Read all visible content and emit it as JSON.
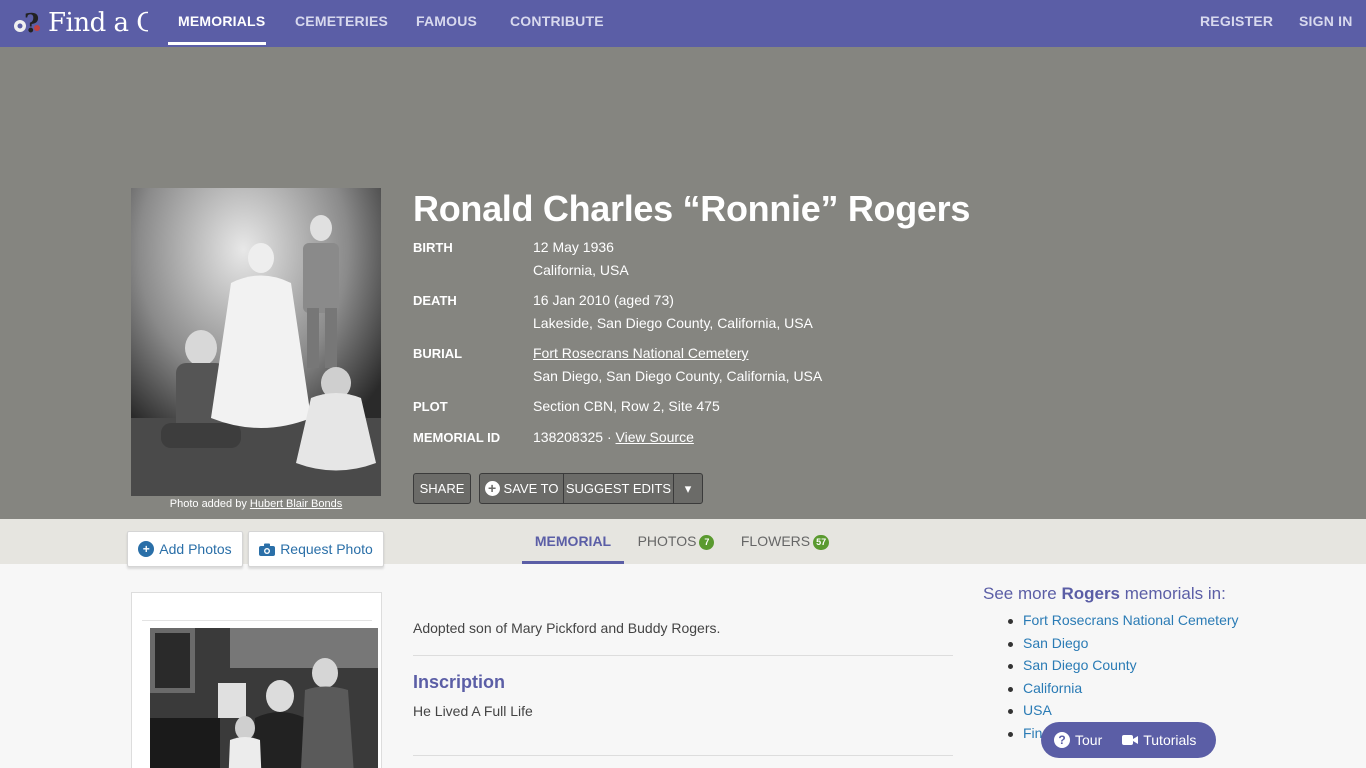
{
  "nav": {
    "logo_text": "Find a Gra",
    "items": [
      "MEMORIALS",
      "CEMETERIES",
      "FAMOUS",
      "CONTRIBUTE"
    ],
    "register": "REGISTER",
    "signin": "SIGN IN"
  },
  "memorial": {
    "name": "Ronald Charles “Ronnie” Rogers",
    "photo_credit_prefix": "Photo added by",
    "photo_credit_name": "Hubert Blair Bonds",
    "facts": {
      "birth_label": "BIRTH",
      "birth_date": "12 May 1936",
      "birth_place": "California, USA",
      "death_label": "DEATH",
      "death_date": "16 Jan 2010 (aged 73)",
      "death_place": "Lakeside, San Diego County, California, USA",
      "burial_label": "BURIAL",
      "burial_cemetery": "Fort Rosecrans National Cemetery",
      "burial_place": "San Diego, San Diego County, California, USA",
      "plot_label": "PLOT",
      "plot_value": "Section CBN, Row 2, Site 475",
      "id_label": "MEMORIAL ID",
      "id_value": "138208325 ·",
      "view_source": "View Source"
    },
    "buttons": {
      "share": "SHARE",
      "save_to": "SAVE TO",
      "suggest_edits": "SUGGEST EDITS",
      "caret": "▾"
    }
  },
  "side_buttons": {
    "add_photos": "Add Photos",
    "request_photo": "Request Photo"
  },
  "tabs": [
    {
      "label": "MEMORIAL"
    },
    {
      "label": "PHOTOS",
      "count": "7"
    },
    {
      "label": "FLOWERS",
      "count": "57"
    }
  ],
  "content": {
    "bio": "Adopted son of Mary Pickford and Buddy Rogers.",
    "inscription_title": "Inscription",
    "inscription_text": "He Lived A Full Life"
  },
  "see_more": {
    "prefix": "See more",
    "surname": "Rogers",
    "suffix": "memorials in:",
    "links": [
      "Fort Rosecrans National Cemetery",
      "San Diego",
      "San Diego County",
      "California",
      "USA",
      "Fin"
    ]
  },
  "floater": {
    "tour": "Tour",
    "tutorials": "Tutorials"
  },
  "colors": {
    "nav": "#5b5ea6",
    "hero": "#858580",
    "link": "#2a7bb5",
    "badge": "#5a9a2f"
  }
}
